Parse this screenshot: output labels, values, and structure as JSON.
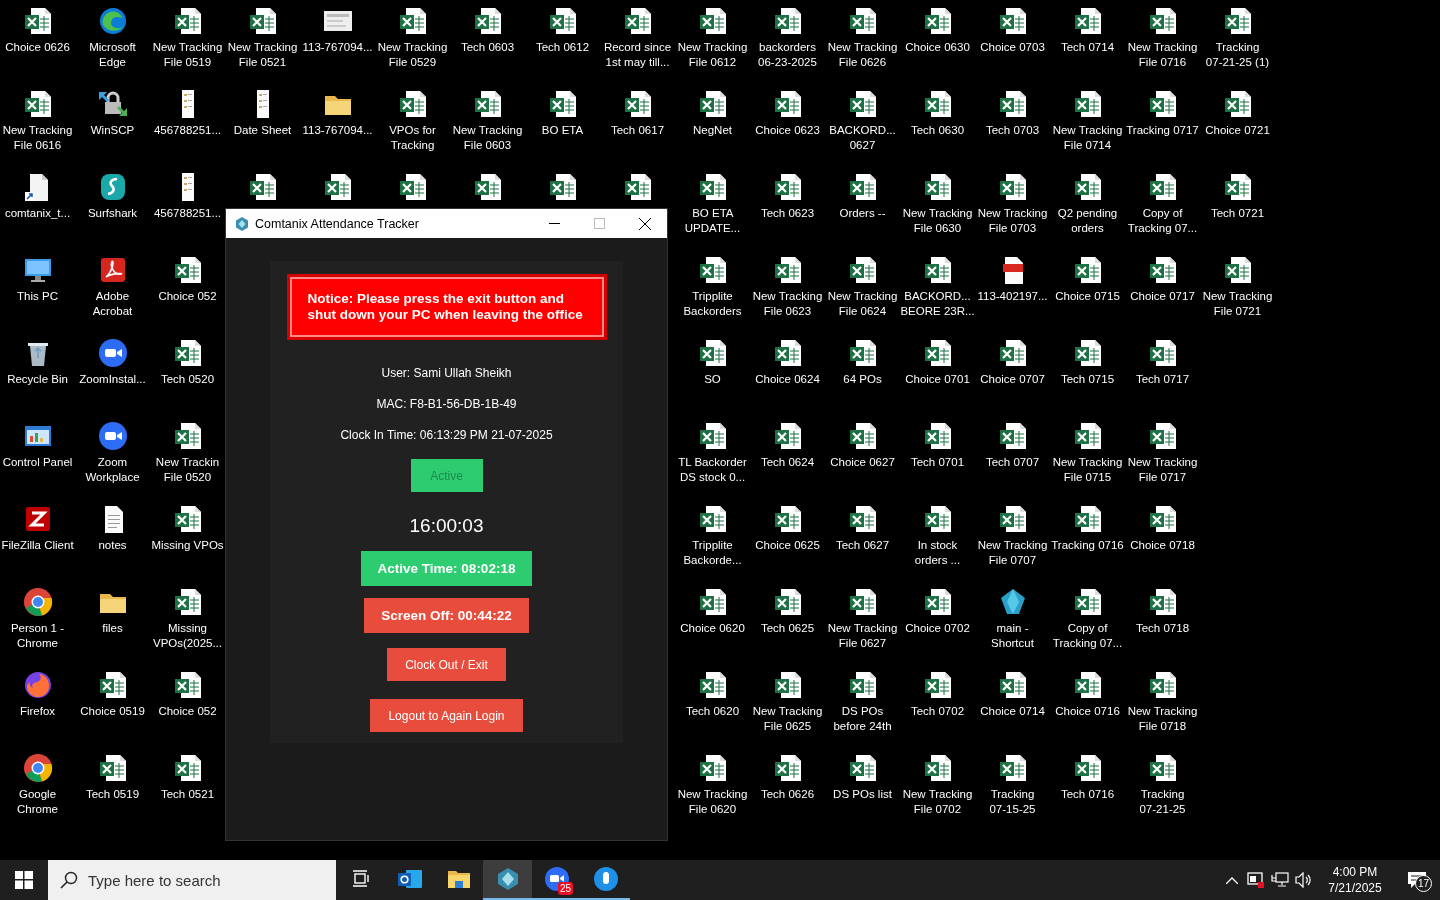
{
  "desktop": {
    "columns": [
      [
        {
          "kind": "excel",
          "label": "Choice 0626"
        },
        {
          "kind": "excel",
          "label": "New Tracking File 0616"
        },
        {
          "kind": "document",
          "label": "comtanix_t..."
        },
        {
          "kind": "monitor",
          "label": "This PC"
        },
        {
          "kind": "recycle",
          "label": "Recycle Bin"
        },
        {
          "kind": "control",
          "label": "Control Panel"
        },
        {
          "kind": "filezilla",
          "label": "FileZilla Client"
        },
        {
          "kind": "chrome",
          "label": "Person 1 - Chrome"
        },
        {
          "kind": "firefox",
          "label": "Firefox"
        },
        {
          "kind": "chrome",
          "label": "Google Chrome"
        }
      ],
      [
        {
          "kind": "edge",
          "label": "Microsoft Edge"
        },
        {
          "kind": "winscp",
          "label": "WinSCP"
        },
        {
          "kind": "surfshark",
          "label": "Surfshark"
        },
        {
          "kind": "acrobat",
          "label": "Adobe Acrobat"
        },
        {
          "kind": "zoom",
          "label": "ZoomInstal..."
        },
        {
          "kind": "zoom",
          "label": "Zoom Workplace"
        },
        {
          "kind": "notes",
          "label": "notes"
        },
        {
          "kind": "folder",
          "label": "files"
        },
        {
          "kind": "excel",
          "label": "Choice 0519"
        },
        {
          "kind": "excel",
          "label": "Tech 0519"
        }
      ],
      [
        {
          "kind": "excel",
          "label": "New Tracking File 0519"
        },
        {
          "kind": "sheet",
          "label": "456788251..."
        },
        {
          "kind": "sheet",
          "label": "456788251..."
        },
        {
          "kind": "excel",
          "label": "Choice 052"
        },
        {
          "kind": "excel",
          "label": "Tech 0520"
        },
        {
          "kind": "excel",
          "label": "New Trackin File 0520"
        },
        {
          "kind": "excel",
          "label": "Missing VPOs"
        },
        {
          "kind": "excel",
          "label": "Missing VPOs(2025..."
        },
        {
          "kind": "excel",
          "label": "Choice 052"
        },
        {
          "kind": "excel",
          "label": "Tech 0521"
        }
      ],
      [
        {
          "kind": "excel",
          "label": "New Tracking File 0521"
        },
        {
          "kind": "sheet",
          "label": "Date Sheet"
        },
        {
          "kind": "excel"
        }
      ],
      [
        {
          "kind": "thumbnail",
          "label": "113-767094..."
        },
        {
          "kind": "folder",
          "label": "113-767094..."
        },
        {
          "kind": "excel"
        }
      ],
      [
        {
          "kind": "excel",
          "label": "New Tracking File 0529"
        },
        {
          "kind": "excel",
          "label": "VPOs for Tracking"
        },
        {
          "kind": "excel"
        }
      ],
      [
        {
          "kind": "excel",
          "label": "Tech 0603"
        },
        {
          "kind": "excel",
          "label": "New Tracking File 0603"
        },
        {
          "kind": "excel"
        }
      ],
      [
        {
          "kind": "excel",
          "label": "Tech 0612"
        },
        {
          "kind": "excel",
          "label": "BO ETA"
        },
        {
          "kind": "excel"
        }
      ],
      [
        {
          "kind": "excel",
          "label": "Record since 1st may till..."
        },
        {
          "kind": "excel",
          "label": "Tech 0617"
        },
        {
          "kind": "excel"
        }
      ],
      [
        {
          "kind": "excel",
          "label": "New Tracking File 0612"
        },
        {
          "kind": "excel",
          "label": "NegNet"
        },
        {
          "kind": "excel",
          "label": "BO ETA UPDATE..."
        },
        {
          "kind": "excel",
          "label": "Tripplite Backorders"
        },
        {
          "kind": "excel",
          "label": "SO"
        },
        {
          "kind": "excel",
          "label": "TL Backorder DS stock 0..."
        },
        {
          "kind": "excel",
          "label": "Tripplite Backorde..."
        },
        {
          "kind": "excel",
          "label": "Choice 0620"
        },
        {
          "kind": "excel",
          "label": "Tech 0620"
        },
        {
          "kind": "excel",
          "label": "New Tracking File 0620"
        }
      ],
      [
        {
          "kind": "excel",
          "label": "backorders 06-23-2025"
        },
        {
          "kind": "excel",
          "label": "Choice 0623"
        },
        {
          "kind": "excel",
          "label": "Tech 0623"
        },
        {
          "kind": "excel",
          "label": "New Tracking File 0623"
        },
        {
          "kind": "excel",
          "label": "Choice 0624"
        },
        {
          "kind": "excel",
          "label": "Tech 0624"
        },
        {
          "kind": "excel",
          "label": "Choice 0625"
        },
        {
          "kind": "excel",
          "label": "Tech 0625"
        },
        {
          "kind": "excel",
          "label": "New Tracking File 0625"
        },
        {
          "kind": "excel",
          "label": "Tech 0626"
        }
      ],
      [
        {
          "kind": "excel",
          "label": "New Tracking File 0626"
        },
        {
          "kind": "excel",
          "label": "BACKORD... 0627"
        },
        {
          "kind": "excel",
          "label": "Orders --"
        },
        {
          "kind": "excel",
          "label": "New Tracking File 0624"
        },
        {
          "kind": "excel",
          "label": "64 POs"
        },
        {
          "kind": "excel",
          "label": "Choice 0627"
        },
        {
          "kind": "excel",
          "label": "Tech 0627"
        },
        {
          "kind": "excel",
          "label": "New Tracking File 0627"
        },
        {
          "kind": "excel",
          "label": "DS POs before 24th"
        },
        {
          "kind": "excel",
          "label": "DS POs list"
        }
      ],
      [
        {
          "kind": "excel",
          "label": "Choice 0630"
        },
        {
          "kind": "excel",
          "label": "Tech 0630"
        },
        {
          "kind": "excel",
          "label": "New Tracking File 0630"
        },
        {
          "kind": "excel",
          "label": "BACKORD... BEORE 23R..."
        },
        {
          "kind": "excel",
          "label": "Choice 0701"
        },
        {
          "kind": "excel",
          "label": "Tech 0701"
        },
        {
          "kind": "excel",
          "label": "In stock orders ..."
        },
        {
          "kind": "excel",
          "label": "Choice 0702"
        },
        {
          "kind": "excel",
          "label": "Tech 0702"
        },
        {
          "kind": "excel",
          "label": "New Tracking File 0702"
        }
      ],
      [
        {
          "kind": "excel",
          "label": "Choice 0703"
        },
        {
          "kind": "excel",
          "label": "Tech 0703"
        },
        {
          "kind": "excel",
          "label": "New Tracking File 0703"
        },
        {
          "kind": "pdf",
          "label": "113-402197..."
        },
        {
          "kind": "excel",
          "label": "Choice 0707"
        },
        {
          "kind": "excel",
          "label": "Tech 0707"
        },
        {
          "kind": "excel",
          "label": "New Tracking File 0707"
        },
        {
          "kind": "app",
          "label": "main - Shortcut"
        },
        {
          "kind": "excel",
          "label": "Choice 0714"
        },
        {
          "kind": "excel",
          "label": "Tracking 07-15-25"
        }
      ],
      [
        {
          "kind": "excel",
          "label": "Tech 0714"
        },
        {
          "kind": "excel",
          "label": "New Tracking File 0714"
        },
        {
          "kind": "excel",
          "label": "Q2 pending orders"
        },
        {
          "kind": "excel",
          "label": "Choice 0715"
        },
        {
          "kind": "excel",
          "label": "Tech 0715"
        },
        {
          "kind": "excel",
          "label": "New Tracking File 0715"
        },
        {
          "kind": "excel",
          "label": "Tracking 0716"
        },
        {
          "kind": "excel",
          "label": "Copy of Tracking 07..."
        },
        {
          "kind": "excel",
          "label": "Choice 0716"
        },
        {
          "kind": "excel",
          "label": "Tech 0716"
        }
      ],
      [
        {
          "kind": "excel",
          "label": "New Tracking File 0716"
        },
        {
          "kind": "excel",
          "label": "Tracking 0717"
        },
        {
          "kind": "excel",
          "label": "Copy of Tracking 07..."
        },
        {
          "kind": "excel",
          "label": "Choice 0717"
        },
        {
          "kind": "excel",
          "label": "Tech 0717"
        },
        {
          "kind": "excel",
          "label": "New Tracking File 0717"
        },
        {
          "kind": "excel",
          "label": "Choice 0718"
        },
        {
          "kind": "excel",
          "label": "Tech 0718"
        },
        {
          "kind": "excel",
          "label": "New Tracking File 0718"
        },
        {
          "kind": "excel",
          "label": "Tracking 07-21-25"
        }
      ],
      [
        {
          "kind": "excel",
          "label": "Tracking 07-21-25 (1)"
        },
        {
          "kind": "excel",
          "label": "Choice 0721"
        },
        {
          "kind": "excel",
          "label": "Tech 0721"
        },
        {
          "kind": "excel",
          "label": "New Tracking File 0721"
        }
      ]
    ]
  },
  "window": {
    "title": "Comtanix Attendance Tracker",
    "notice": "Notice: Please press the exit button and shut down your PC when leaving the office",
    "info": [
      "User: Sami Ullah Sheikh",
      "MAC: F8-B1-56-DB-1B-49",
      "Clock In Time: 06:13:29 PM 21-07-2025"
    ],
    "status": "Active",
    "clock": "16:00:03",
    "stats": [
      {
        "label": "Active Time: 08:02:18",
        "color": "#2ecc71"
      },
      {
        "label": "Screen Off: 00:44:22",
        "color": "#e74c3c"
      }
    ],
    "buttons": [
      "Clock Out / Exit",
      "Logout to Again Login"
    ]
  },
  "taskbar": {
    "search": {
      "placeholder": "Type here to search"
    },
    "apps": [
      {
        "kind": "taskview",
        "selected": false
      },
      {
        "kind": "mail",
        "selected": false
      },
      {
        "kind": "folder",
        "selected": false
      },
      {
        "kind": "tracker",
        "selected": true
      },
      {
        "kind": "zoom",
        "selected": false,
        "badge": "25"
      },
      {
        "kind": "bluedot",
        "selected": false
      }
    ],
    "time": "4:00 PM",
    "date": "7/21/2025",
    "notifications": "17"
  }
}
